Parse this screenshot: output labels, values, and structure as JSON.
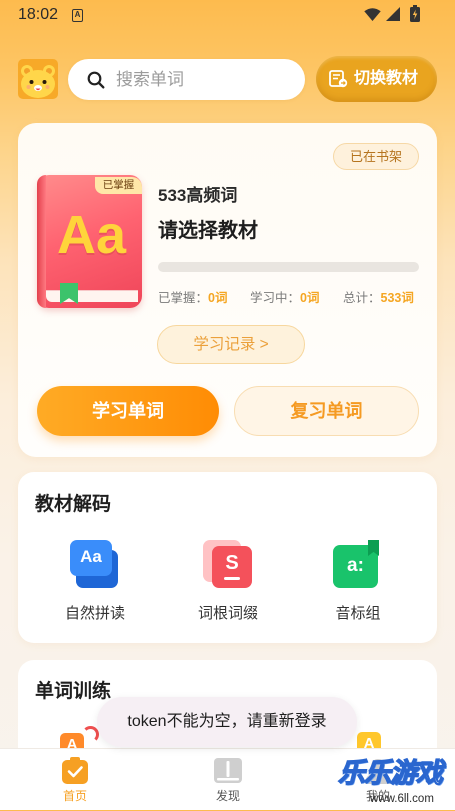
{
  "status_bar": {
    "time": "18:02",
    "notification_glyph": "A",
    "icons": [
      "wifi-icon",
      "signal-icon",
      "battery-charging-icon"
    ]
  },
  "header": {
    "avatar_icon": "bear-avatar",
    "search": {
      "icon": "search-icon",
      "placeholder": "搜索单词"
    },
    "switch_button": {
      "icon": "textbook-switch-icon",
      "label": "切换教材"
    }
  },
  "book_card": {
    "shelf_badge": "已在书架",
    "cover": {
      "letters": "Aa",
      "tag": "已掌握"
    },
    "book_name": "533高频词",
    "prompt": "请选择教材",
    "progress": 0,
    "stats": [
      {
        "label": "已掌握：",
        "value": "0词"
      },
      {
        "label": "学习中：",
        "value": "0词"
      },
      {
        "label": "总计：",
        "value": "533词"
      }
    ],
    "record_button": "学习记录 >",
    "learn_button": "学习单词",
    "review_button": "复习单词"
  },
  "decode_section": {
    "title": "教材解码",
    "items": [
      {
        "label": "自然拼读",
        "icon": "phonics-icon",
        "glyph": "Aa",
        "color": "#3A8DFA"
      },
      {
        "label": "词根词缀",
        "icon": "root-affix-icon",
        "glyph": "S",
        "color": "#F4515B"
      },
      {
        "label": "音标组",
        "icon": "phonetic-symbol-icon",
        "glyph": "a:",
        "color": "#19C36B"
      }
    ]
  },
  "training_section": {
    "title": "单词训练",
    "items": [
      {
        "icon": "letter-a-icon",
        "glyph": "A",
        "color": "#FF8A2A"
      },
      {
        "icon": "letter-a-icon",
        "glyph": "A",
        "color": "#FFC72C"
      }
    ]
  },
  "toast": {
    "message": "token不能为空，请重新登录"
  },
  "bottom_nav": {
    "items": [
      {
        "label": "首页",
        "icon": "home-icon",
        "active": true
      },
      {
        "label": "发现",
        "icon": "discover-icon",
        "active": false
      },
      {
        "label": "我的",
        "icon": "profile-icon",
        "active": false
      }
    ]
  },
  "watermark": {
    "title": "乐乐游戏",
    "url": "www.6ll.com"
  },
  "theme": {
    "accent": "#F9A125",
    "accent_dark": "#E9A41F",
    "primary_start": "#FFAB25",
    "primary_end": "#FF8C04",
    "stat_value": "#F5A623",
    "badge_text": "#B5741E",
    "toast_bg": "#F6EFF4",
    "nav_active": "#F6A023",
    "nav_inactive": "#555555"
  }
}
